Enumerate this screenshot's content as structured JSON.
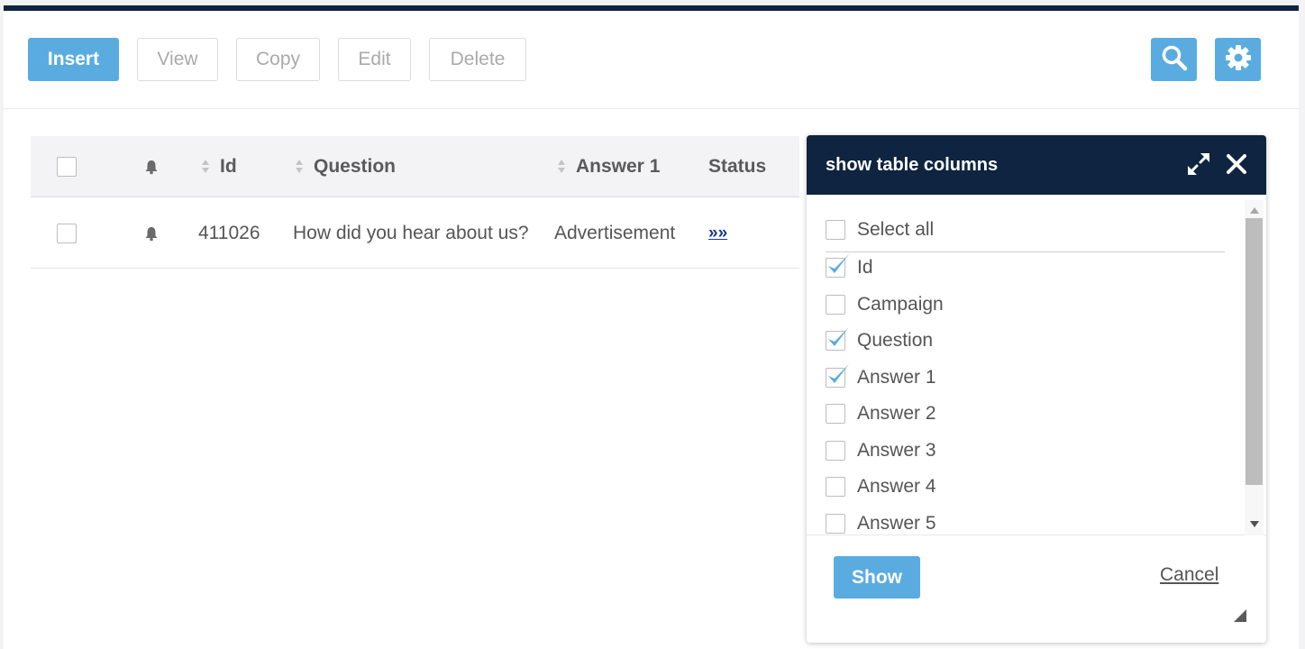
{
  "toolbar": {
    "insert": "Insert",
    "view": "View",
    "copy": "Copy",
    "edit": "Edit",
    "delete": "Delete",
    "search_icon": "search-icon",
    "settings_icon": "gear-icon"
  },
  "table": {
    "columns": [
      "Id",
      "Question",
      "Answer 1",
      "Status"
    ],
    "rows": [
      {
        "id": "411026",
        "question": "How did you hear about us?",
        "answer1": "Advertisement",
        "status": "»»"
      }
    ]
  },
  "modal": {
    "title": "show table columns",
    "select_all": "Select all",
    "items": [
      {
        "label": "Id",
        "checked": true
      },
      {
        "label": "Campaign",
        "checked": false
      },
      {
        "label": "Question",
        "checked": true
      },
      {
        "label": "Answer 1",
        "checked": true
      },
      {
        "label": "Answer 2",
        "checked": false
      },
      {
        "label": "Answer 3",
        "checked": false
      },
      {
        "label": "Answer 4",
        "checked": false
      },
      {
        "label": "Answer 5",
        "checked": false
      }
    ],
    "show_label": "Show",
    "cancel_label": "Cancel"
  },
  "colors": {
    "accent": "#5aace0",
    "header_dark": "#0e2440",
    "check": "#5aace0",
    "link": "#1a3a8e"
  }
}
